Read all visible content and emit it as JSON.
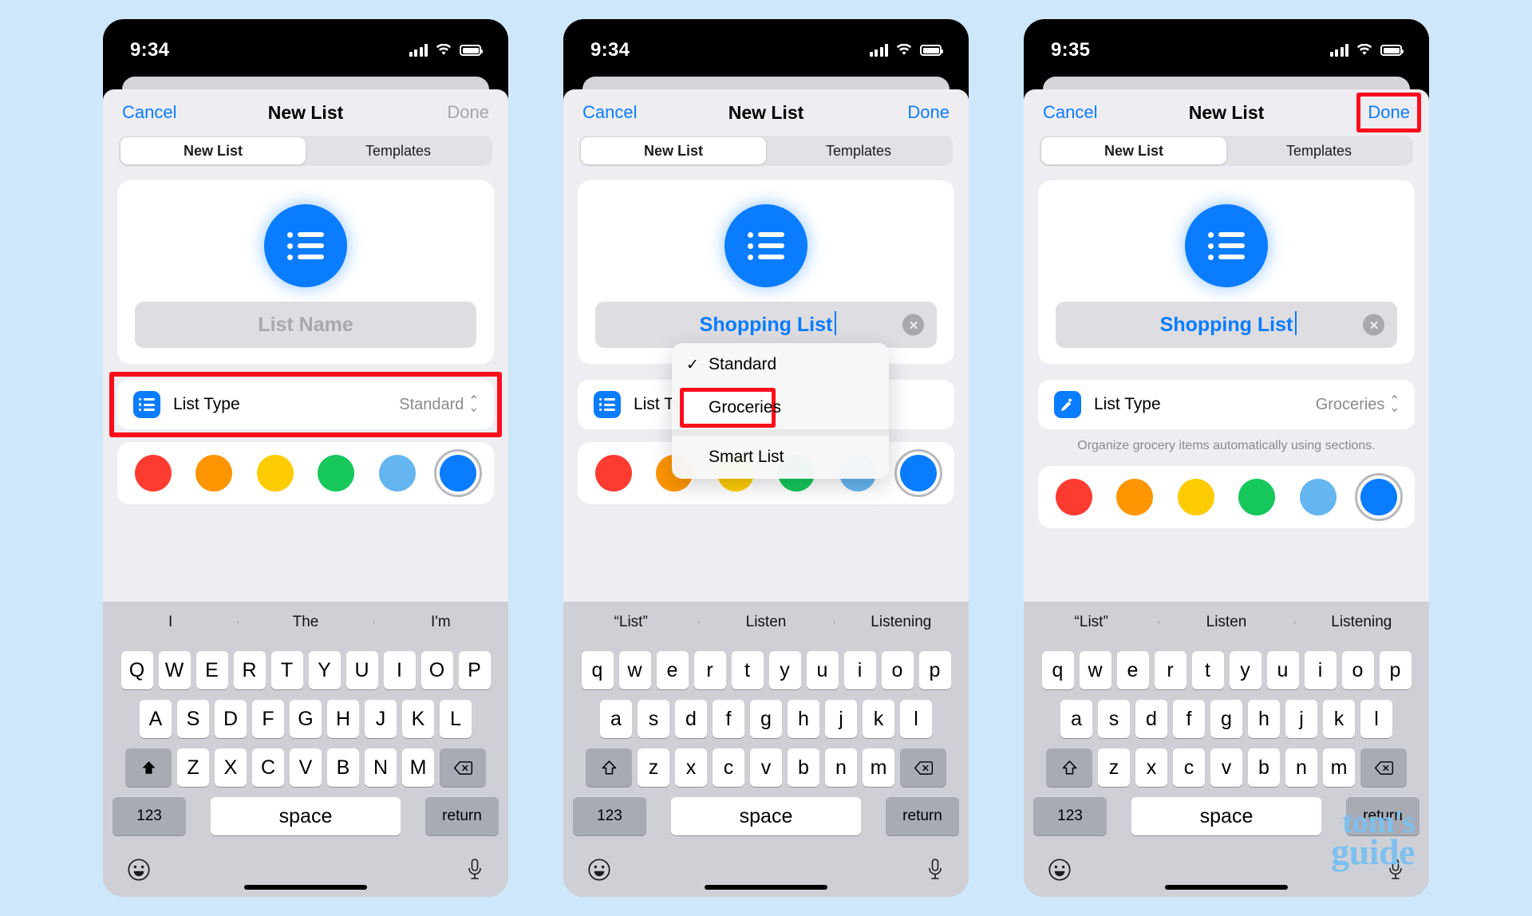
{
  "panels": [
    {
      "id": "panel-left",
      "status": {
        "time": "9:34",
        "signal_icon": "cellular-bars-icon",
        "wifi_icon": "wifi-icon",
        "battery_icon": "battery-icon"
      },
      "nav": {
        "cancel": "Cancel",
        "title": "New List",
        "done": "Done",
        "done_enabled": false
      },
      "segments": [
        {
          "label": "New List",
          "active": true
        },
        {
          "label": "Templates",
          "active": false
        }
      ],
      "name_field": {
        "placeholder": "List Name",
        "value": "",
        "has_clear": false
      },
      "list_type": {
        "label": "List Type",
        "value": "Standard",
        "icon": "list-bullet-icon",
        "helper": ""
      },
      "colors": [
        "#fe3b30",
        "#fd9500",
        "#fecc00",
        "#16c75b",
        "#64b5f0",
        "#0a7cff"
      ],
      "selected_color_index": 5,
      "keyboard": {
        "suggestions": [
          "I",
          "The",
          "I'm"
        ],
        "row1": [
          "Q",
          "W",
          "E",
          "R",
          "T",
          "Y",
          "U",
          "I",
          "O",
          "P"
        ],
        "row2": [
          "A",
          "S",
          "D",
          "F",
          "G",
          "H",
          "J",
          "K",
          "L"
        ],
        "row3": [
          "Z",
          "X",
          "C",
          "V",
          "B",
          "N",
          "M"
        ],
        "shift_icon": "shift-filled-icon",
        "backspace_icon": "backspace-icon",
        "numbers_label": "123",
        "space_label": "space",
        "return_label": "return",
        "emoji_icon": "emoji-icon",
        "mic_icon": "microphone-icon"
      },
      "menu": null,
      "highlight": "list-type-row"
    },
    {
      "id": "panel-middle",
      "status": {
        "time": "9:34",
        "signal_icon": "cellular-bars-icon",
        "wifi_icon": "wifi-icon",
        "battery_icon": "battery-icon"
      },
      "nav": {
        "cancel": "Cancel",
        "title": "New List",
        "done": "Done",
        "done_enabled": true
      },
      "segments": [
        {
          "label": "New List",
          "active": true
        },
        {
          "label": "Templates",
          "active": false
        }
      ],
      "name_field": {
        "placeholder": "List Name",
        "value": "Shopping List",
        "has_clear": true
      },
      "list_type": {
        "label": "List Ty",
        "value": "",
        "icon": "list-bullet-icon",
        "helper": ""
      },
      "colors": [
        "#fe3b30",
        "#fd9500",
        "#fecc00",
        "#16c75b",
        "#64b5f0",
        "#0a7cff"
      ],
      "selected_color_index": 5,
      "keyboard": {
        "suggestions": [
          "“List”",
          "Listen",
          "Listening"
        ],
        "row1": [
          "q",
          "w",
          "e",
          "r",
          "t",
          "y",
          "u",
          "i",
          "o",
          "p"
        ],
        "row2": [
          "a",
          "s",
          "d",
          "f",
          "g",
          "h",
          "j",
          "k",
          "l"
        ],
        "row3": [
          "z",
          "x",
          "c",
          "v",
          "b",
          "n",
          "m"
        ],
        "shift_icon": "shift-outline-icon",
        "backspace_icon": "backspace-icon",
        "numbers_label": "123",
        "space_label": "space",
        "return_label": "return",
        "emoji_icon": "emoji-icon",
        "mic_icon": "microphone-icon"
      },
      "menu": {
        "items": [
          {
            "label": "Standard",
            "checked": true
          },
          {
            "label": "Groceries",
            "checked": false,
            "highlighted": true
          },
          {
            "label": "Smart List",
            "checked": false
          }
        ]
      },
      "highlight": "menu-item-groceries"
    },
    {
      "id": "panel-right",
      "status": {
        "time": "9:35",
        "signal_icon": "cellular-bars-icon",
        "wifi_icon": "wifi-icon",
        "battery_icon": "battery-icon"
      },
      "nav": {
        "cancel": "Cancel",
        "title": "New List",
        "done": "Done",
        "done_enabled": true
      },
      "segments": [
        {
          "label": "New List",
          "active": true
        },
        {
          "label": "Templates",
          "active": false
        }
      ],
      "name_field": {
        "placeholder": "List Name",
        "value": "Shopping List",
        "has_clear": true
      },
      "list_type": {
        "label": "List Type",
        "value": "Groceries",
        "icon": "carrot-icon",
        "helper": "Organize grocery items automatically using sections."
      },
      "colors": [
        "#fe3b30",
        "#fd9500",
        "#fecc00",
        "#16c75b",
        "#64b5f0",
        "#0a7cff"
      ],
      "selected_color_index": 5,
      "keyboard": {
        "suggestions": [
          "“List”",
          "Listen",
          "Listening"
        ],
        "row1": [
          "q",
          "w",
          "e",
          "r",
          "t",
          "y",
          "u",
          "i",
          "o",
          "p"
        ],
        "row2": [
          "a",
          "s",
          "d",
          "f",
          "g",
          "h",
          "j",
          "k",
          "l"
        ],
        "row3": [
          "z",
          "x",
          "c",
          "v",
          "b",
          "n",
          "m"
        ],
        "shift_icon": "shift-outline-icon",
        "backspace_icon": "backspace-icon",
        "numbers_label": "123",
        "space_label": "space",
        "return_label": "return",
        "emoji_icon": "emoji-icon",
        "mic_icon": "microphone-icon"
      },
      "menu": null,
      "highlight": "done-button"
    }
  ],
  "watermark": {
    "line1": "tom's",
    "line2": "guide",
    "color": "#7cc0f0"
  },
  "accent": {
    "blue": "#0a7cff",
    "red": "#fb0d1b",
    "background": "#cfe7fa"
  }
}
